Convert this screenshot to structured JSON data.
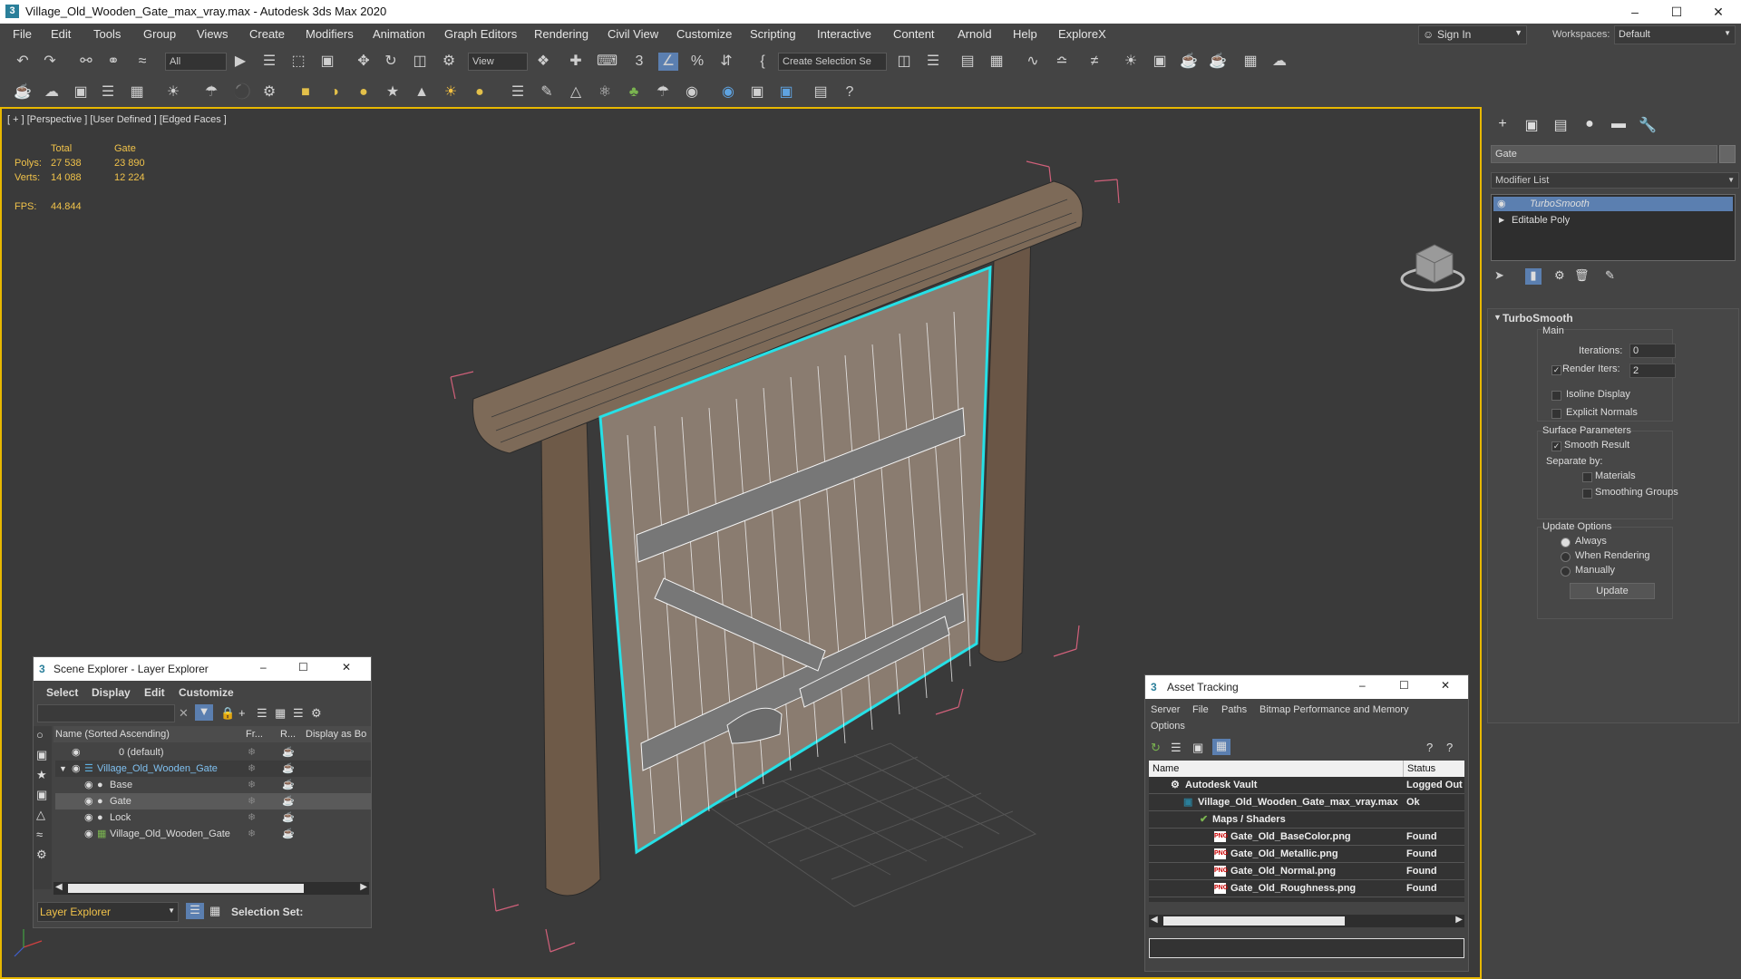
{
  "window": {
    "title": "Village_Old_Wooden_Gate_max_vray.max - Autodesk 3ds Max 2020",
    "app_icon": "3"
  },
  "menu": {
    "items": [
      "File",
      "Edit",
      "Tools",
      "Group",
      "Views",
      "Create",
      "Modifiers",
      "Animation",
      "Graph Editors",
      "Rendering",
      "Civil View",
      "Customize",
      "Scripting",
      "Interactive",
      "Content",
      "Arnold",
      "Help",
      "ExploreX"
    ],
    "sign_in": "Sign In",
    "workspaces_label": "Workspaces:",
    "workspace_value": "Default"
  },
  "toolbar": {
    "selection_filter": "All",
    "ref_coord": "View",
    "selection_set": "Create Selection Se"
  },
  "viewport": {
    "label": "[ + ] [Perspective ] [User Defined ] [Edged Faces ]",
    "stats": {
      "col_total": "Total",
      "col_gate": "Gate",
      "polys_label": "Polys:",
      "polys_total": "27 538",
      "polys_gate": "23 890",
      "verts_label": "Verts:",
      "verts_total": "14 088",
      "verts_gate": "12 224",
      "fps_label": "FPS:",
      "fps_value": "44.844"
    }
  },
  "command_panel": {
    "object_name": "Gate",
    "modifier_list": "Modifier List",
    "stack": [
      "TurboSmooth",
      "Editable Poly"
    ],
    "rollout_title": "TurboSmooth",
    "main_label": "Main",
    "iterations_label": "Iterations:",
    "iterations_value": "0",
    "render_iters_label": "Render Iters:",
    "render_iters_value": "2",
    "isoline_display": "Isoline Display",
    "explicit_normals": "Explicit Normals",
    "surface_params": "Surface Parameters",
    "smooth_result": "Smooth Result",
    "separate_by": "Separate by:",
    "materials": "Materials",
    "smoothing_groups": "Smoothing Groups",
    "update_options": "Update Options",
    "always": "Always",
    "when_rendering": "When Rendering",
    "manually": "Manually",
    "update_button": "Update"
  },
  "scene_explorer": {
    "title": "Scene Explorer - Layer Explorer",
    "menu": [
      "Select",
      "Display",
      "Edit",
      "Customize"
    ],
    "columns": [
      "Name (Sorted Ascending)",
      "Fr...",
      "R...",
      "Display as Bo"
    ],
    "rows": [
      {
        "name": "0 (default)",
        "indent": 0
      },
      {
        "name": "Village_Old_Wooden_Gate",
        "indent": 0
      },
      {
        "name": "Base",
        "indent": 1
      },
      {
        "name": "Gate",
        "indent": 1
      },
      {
        "name": "Lock",
        "indent": 1
      },
      {
        "name": "Village_Old_Wooden_Gate",
        "indent": 1
      }
    ],
    "footer_mode": "Layer Explorer",
    "selection_set_label": "Selection Set:"
  },
  "asset_tracking": {
    "title": "Asset Tracking",
    "menu": [
      "Server",
      "File",
      "Paths",
      "Bitmap Performance and Memory",
      "Options"
    ],
    "columns": [
      "Name",
      "Status"
    ],
    "rows": [
      {
        "name": "Autodesk Vault",
        "status": "Logged Out"
      },
      {
        "name": "Village_Old_Wooden_Gate_max_vray.max",
        "status": "Ok"
      },
      {
        "name": "Maps / Shaders",
        "status": ""
      },
      {
        "name": "Gate_Old_BaseColor.png",
        "status": "Found"
      },
      {
        "name": "Gate_Old_Metallic.png",
        "status": "Found"
      },
      {
        "name": "Gate_Old_Normal.png",
        "status": "Found"
      },
      {
        "name": "Gate_Old_Roughness.png",
        "status": "Found"
      }
    ]
  }
}
